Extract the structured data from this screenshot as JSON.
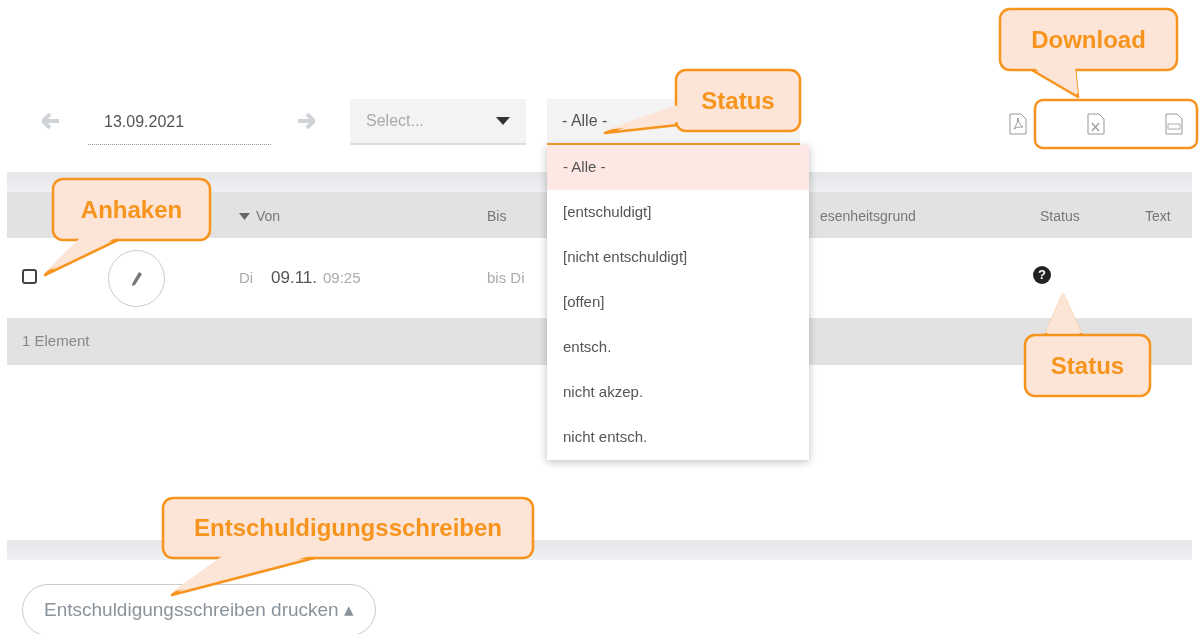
{
  "toolbar": {
    "date": "13.09.2021",
    "class_select": {
      "placeholder": "Select..."
    },
    "status_select": {
      "value": "- Alle -",
      "expanded": true
    }
  },
  "status_options": [
    {
      "label": "- Alle -",
      "selected": true
    },
    {
      "label": "[entschuldigt]",
      "selected": false
    },
    {
      "label": "[nicht entschuldigt]",
      "selected": false
    },
    {
      "label": "[offen]",
      "selected": false
    },
    {
      "label": "entsch.",
      "selected": false
    },
    {
      "label": "nicht akzep.",
      "selected": false
    },
    {
      "label": "nicht entsch.",
      "selected": false
    }
  ],
  "table": {
    "columns": [
      {
        "label": "Von",
        "sorted": true
      },
      {
        "label": "Bis",
        "sorted": false
      },
      {
        "label": "esenheitsgrund",
        "sorted": false
      },
      {
        "label": "Status",
        "sorted": false
      },
      {
        "label": "Text",
        "sorted": false
      }
    ],
    "rows": [
      {
        "checked": false,
        "from_day": "Di",
        "from_date": "09.11.",
        "from_time": "09:25",
        "to": "bis Di",
        "status": "?"
      }
    ],
    "footer": "1 Element"
  },
  "print_button": "Entschuldigungsschreiben drucken ▴",
  "callouts": [
    {
      "text": "Download"
    },
    {
      "text": "Status"
    },
    {
      "text": "Anhaken"
    },
    {
      "text": "Status"
    },
    {
      "text": "Entschuldigungsschreiben"
    }
  ]
}
